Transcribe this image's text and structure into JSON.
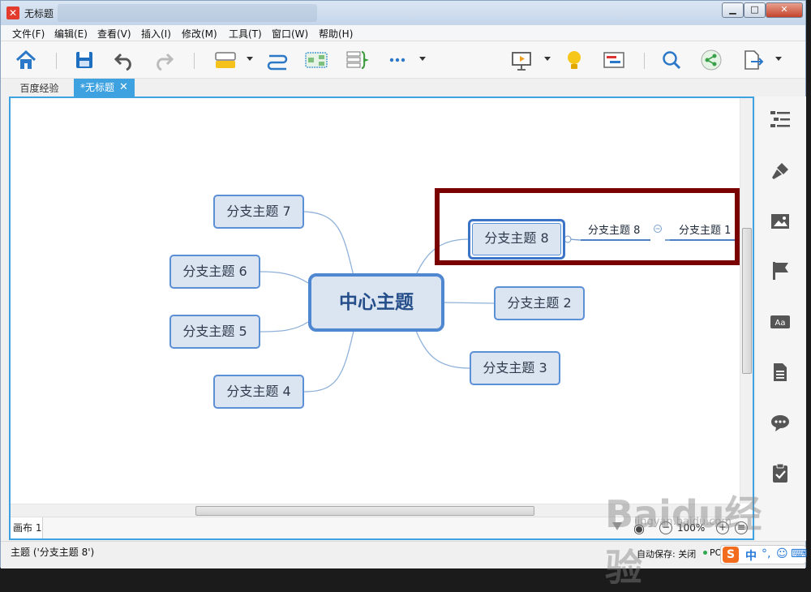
{
  "window": {
    "title": "无标题",
    "app_icon": "xmind-icon"
  },
  "menu": [
    "文件(F)",
    "编辑(E)",
    "查看(V)",
    "插入(I)",
    "修改(M)",
    "工具(T)",
    "窗口(W)",
    "帮助(H)"
  ],
  "toolbar": {
    "icons": [
      "home-icon",
      "save-icon",
      "undo-icon",
      "redo-icon",
      "topic-icon",
      "relationship-icon",
      "boundary-icon",
      "summary-icon",
      "more-icon",
      "presentation-icon",
      "idea-icon",
      "gantt-icon",
      "search-icon",
      "share-icon",
      "export-icon"
    ]
  },
  "tabs": [
    {
      "label": "百度经验",
      "active": false
    },
    {
      "label": "*无标题",
      "active": true
    }
  ],
  "mindmap": {
    "central": "中心主题",
    "branches": [
      {
        "id": "b1",
        "label": "分支主题 8",
        "selected": true
      },
      {
        "id": "b2",
        "label": "分支主题 2"
      },
      {
        "id": "b3",
        "label": "分支主题 3"
      },
      {
        "id": "b4",
        "label": "分支主题 4"
      },
      {
        "id": "b5",
        "label": "分支主题 5"
      },
      {
        "id": "b6",
        "label": "分支主题 6"
      },
      {
        "id": "b7",
        "label": "分支主题 7"
      }
    ],
    "subtopics": [
      {
        "label": "分支主题 8"
      },
      {
        "label": "分支主题 1"
      }
    ],
    "annotation_color": "#7a0000"
  },
  "bottom": {
    "sheet": "画布 1",
    "zoom": "100%"
  },
  "status": {
    "topic": "主题 ('分支主题 8')",
    "autosave": "自动保存: 关闭",
    "po": "PO"
  },
  "ime": {
    "logo": "S",
    "lang": "中",
    "icons": [
      "punctuation-icon",
      "emoji-icon",
      "keyboard-icon"
    ]
  },
  "sidepanel": [
    "outline-icon",
    "format-brush-icon",
    "image-icon",
    "marker-flag-icon",
    "text-style-icon",
    "notes-icon",
    "comment-icon",
    "task-clipboard-icon"
  ],
  "watermark": {
    "brand": "Baidu经验",
    "url": "jingyan.baidu.com"
  },
  "colors": {
    "accent": "#3ea1e0",
    "node_fill": "#dbe5f1",
    "node_border": "#5b8fd6"
  }
}
